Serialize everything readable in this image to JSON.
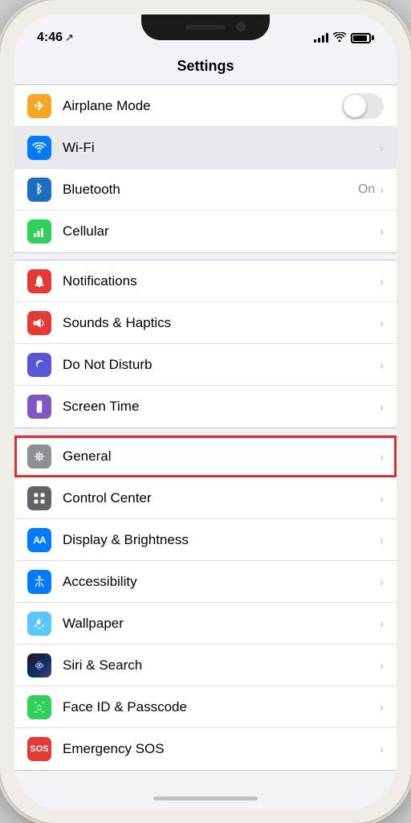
{
  "statusBar": {
    "time": "4:46",
    "locationIcon": "›"
  },
  "page": {
    "title": "Settings"
  },
  "sections": [
    {
      "id": "connectivity",
      "rows": [
        {
          "id": "airplane-mode",
          "iconBg": "icon-orange",
          "iconSymbol": "✈",
          "label": "Airplane Mode",
          "valueType": "toggle",
          "toggleOn": false,
          "chevron": false
        },
        {
          "id": "wifi",
          "iconBg": "icon-blue",
          "iconSymbol": "wifi",
          "label": "Wi-Fi",
          "valueType": "highlight",
          "value": "",
          "chevron": true,
          "rowBg": "wifi-row-bg"
        },
        {
          "id": "bluetooth",
          "iconBg": "icon-blue-dark",
          "iconSymbol": "bluetooth",
          "label": "Bluetooth",
          "value": "On",
          "valueType": "text",
          "chevron": true
        },
        {
          "id": "cellular",
          "iconBg": "icon-green",
          "iconSymbol": "cellular",
          "label": "Cellular",
          "valueType": "chevron",
          "chevron": true
        }
      ]
    },
    {
      "id": "notifications-group",
      "rows": [
        {
          "id": "notifications",
          "iconBg": "icon-red",
          "iconSymbol": "notif",
          "label": "Notifications",
          "valueType": "chevron",
          "chevron": true
        },
        {
          "id": "sounds",
          "iconBg": "icon-pink-red",
          "iconSymbol": "sounds",
          "label": "Sounds & Haptics",
          "valueType": "chevron",
          "chevron": true
        },
        {
          "id": "dnd",
          "iconBg": "icon-purple",
          "iconSymbol": "moon",
          "label": "Do Not Disturb",
          "valueType": "chevron",
          "chevron": true
        },
        {
          "id": "screentime",
          "iconBg": "icon-purple-light",
          "iconSymbol": "hourglass",
          "label": "Screen Time",
          "valueType": "chevron",
          "chevron": true
        }
      ]
    },
    {
      "id": "general-group",
      "rows": [
        {
          "id": "general",
          "iconBg": "icon-gray",
          "iconSymbol": "gear",
          "label": "General",
          "valueType": "chevron",
          "chevron": true,
          "highlighted": true
        },
        {
          "id": "control-center",
          "iconBg": "icon-gray-dark",
          "iconSymbol": "controlcenter",
          "label": "Control Center",
          "valueType": "chevron",
          "chevron": true
        },
        {
          "id": "display",
          "iconBg": "icon-aa",
          "iconSymbol": "AA",
          "label": "Display & Brightness",
          "valueType": "chevron",
          "chevron": true
        },
        {
          "id": "accessibility",
          "iconBg": "icon-accessibility",
          "iconSymbol": "person",
          "label": "Accessibility",
          "valueType": "chevron",
          "chevron": true
        },
        {
          "id": "wallpaper",
          "iconBg": "icon-flower",
          "iconSymbol": "flower",
          "label": "Wallpaper",
          "valueType": "chevron",
          "chevron": true
        },
        {
          "id": "siri",
          "iconBg": "icon-siri",
          "iconSymbol": "siri",
          "label": "Siri & Search",
          "valueType": "chevron",
          "chevron": true
        },
        {
          "id": "faceid",
          "iconBg": "icon-green-face",
          "iconSymbol": "faceid",
          "label": "Face ID & Passcode",
          "valueType": "chevron",
          "chevron": true
        },
        {
          "id": "sos",
          "iconBg": "icon-sos",
          "iconSymbol": "SOS",
          "label": "Emergency SOS",
          "valueType": "chevron",
          "chevron": true
        }
      ]
    }
  ]
}
